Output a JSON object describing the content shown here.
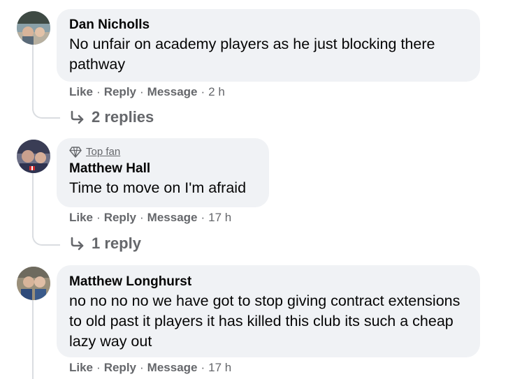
{
  "comments": [
    {
      "author": "Dan Nicholls",
      "text": "No unfair on academy players as he just blocking there pathway",
      "badge": "",
      "actions": {
        "like": "Like",
        "reply": "Reply",
        "message": "Message",
        "time": "2 h"
      },
      "replies": "2 replies"
    },
    {
      "author": "Matthew Hall",
      "text": "Time to move on I'm afraid",
      "badge": "Top fan",
      "actions": {
        "like": "Like",
        "reply": "Reply",
        "message": "Message",
        "time": "17 h"
      },
      "replies": "1 reply"
    },
    {
      "author": "Matthew Longhurst",
      "text": "no no no no we have got to stop giving contract extensions to old past it players it has killed this club its such a cheap lazy way out",
      "badge": "",
      "actions": {
        "like": "Like",
        "reply": "Reply",
        "message": "Message",
        "time": "17 h"
      },
      "replies": ""
    }
  ],
  "separator": "·",
  "colors": {
    "bubble_bg": "#f0f2f5",
    "text": "#050505",
    "secondary_text": "#65676b",
    "thread_line": "#dadde1"
  },
  "icons": {
    "reply_arrow": "reply-arrow-icon",
    "top_fan": "diamond-icon"
  }
}
